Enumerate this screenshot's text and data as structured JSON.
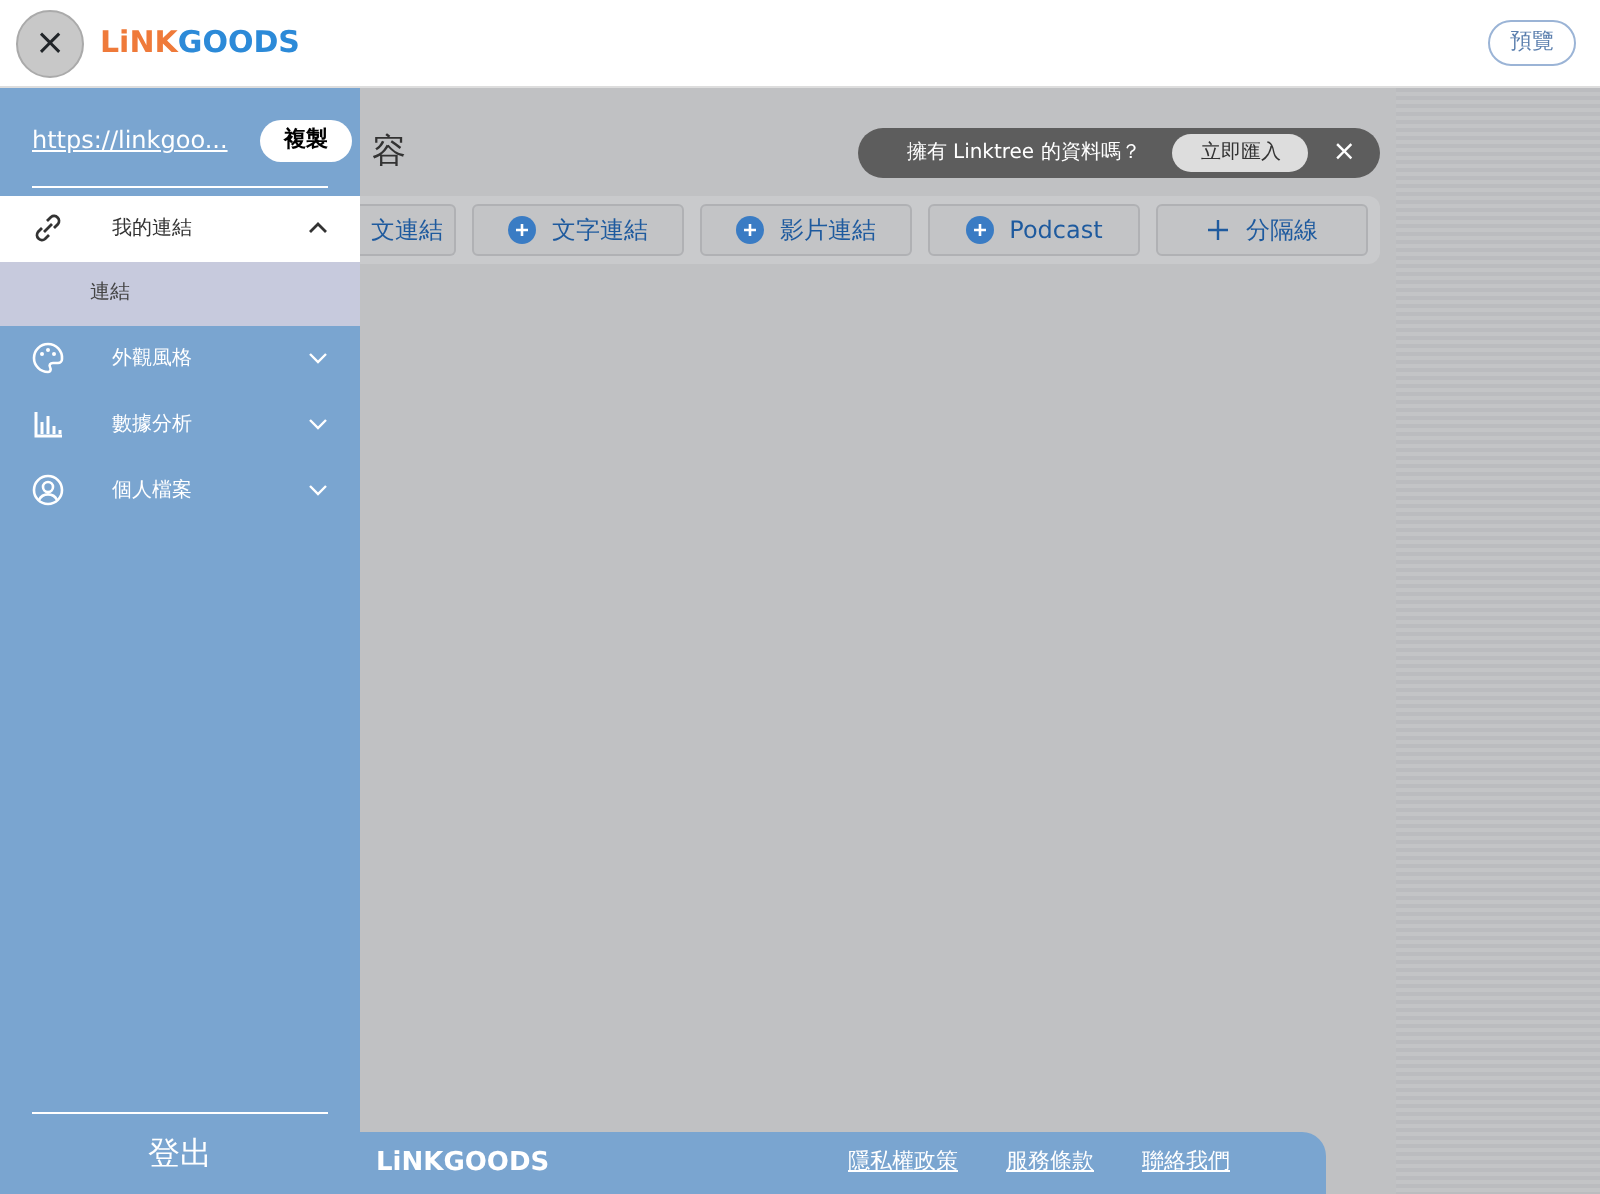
{
  "header": {
    "close_button": "×",
    "logo_accent": "LiNK",
    "logo_rest": "GOODS",
    "preview_button": "預覽"
  },
  "sidebar": {
    "url": "https://linkgoo...",
    "copy_button": "複製",
    "items": [
      {
        "label": "我的連結",
        "expanded": true,
        "children": [
          {
            "label": "連結",
            "selected": true
          }
        ]
      },
      {
        "label": "外觀風格",
        "expanded": false
      },
      {
        "label": "數據分析",
        "expanded": false
      },
      {
        "label": "個人檔案",
        "expanded": false
      }
    ],
    "logout": "登出"
  },
  "main": {
    "title": "容",
    "import_banner": {
      "text": "擁有 Linktree 的資料嗎？",
      "button": "立即匯入",
      "close": "×"
    },
    "add_buttons": [
      {
        "label": "文連結",
        "kind": "partial"
      },
      {
        "label": "文字連結",
        "kind": "media"
      },
      {
        "label": "影片連結",
        "kind": "media"
      },
      {
        "label": "Podcast",
        "kind": "media"
      },
      {
        "label": "分隔線",
        "kind": "divider"
      }
    ]
  },
  "footer": {
    "logo": "LiNKGOODS",
    "links": [
      "隱私權政策",
      "服務條款",
      "聯絡我們"
    ]
  }
}
